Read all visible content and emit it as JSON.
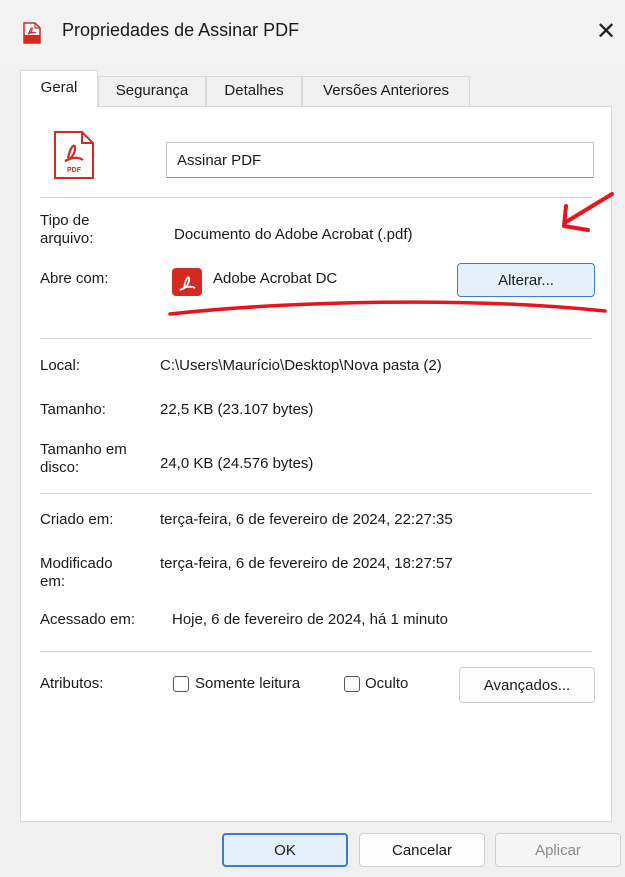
{
  "window": {
    "title": "Propriedades de Assinar PDF",
    "close_glyph": "✕"
  },
  "tabs": [
    {
      "label": "Geral",
      "active": true
    },
    {
      "label": "Segurança",
      "active": false
    },
    {
      "label": "Detalhes",
      "active": false
    },
    {
      "label": "Versões Anteriores",
      "active": false
    }
  ],
  "general": {
    "file_name": "Assinar PDF",
    "file_type_label": "Tipo de\narquivo:",
    "file_type_value": "Documento do Adobe Acrobat (.pdf)",
    "opens_with_label": "Abre com:",
    "opens_with_value": "Adobe Acrobat DC",
    "change_button": "Alterar...",
    "location_label": "Local:",
    "location_value": "C:\\Users\\Maurício\\Desktop\\Nova pasta (2)",
    "size_label": "Tamanho:",
    "size_value": "22,5 KB (23.107 bytes)",
    "disk_size_label": "Tamanho em\ndisco:",
    "disk_size_value": "24,0 KB (24.576 bytes)",
    "created_label": "Criado em:",
    "created_value": "terça-feira, 6 de fevereiro de 2024, 22:27:35",
    "modified_label": "Modificado\nem:",
    "modified_value": "terça-feira, 6 de fevereiro de 2024, 18:27:57",
    "accessed_label": "Acessado em:",
    "accessed_value": "Hoje, 6 de fevereiro de 2024, há 1 minuto",
    "attributes_label": "Atributos:",
    "readonly_label": "Somente leitura",
    "hidden_label": "Oculto",
    "advanced_button": "Avançados..."
  },
  "footer": {
    "ok": "OK",
    "cancel": "Cancelar",
    "apply": "Aplicar"
  },
  "colors": {
    "accent": "#3a7bd5",
    "pdf_red": "#d32a22",
    "annotation_red": "#e8141c"
  },
  "icons": {
    "title": "pdf-icon",
    "file": "pdf-file-icon",
    "app": "acrobat-icon"
  }
}
